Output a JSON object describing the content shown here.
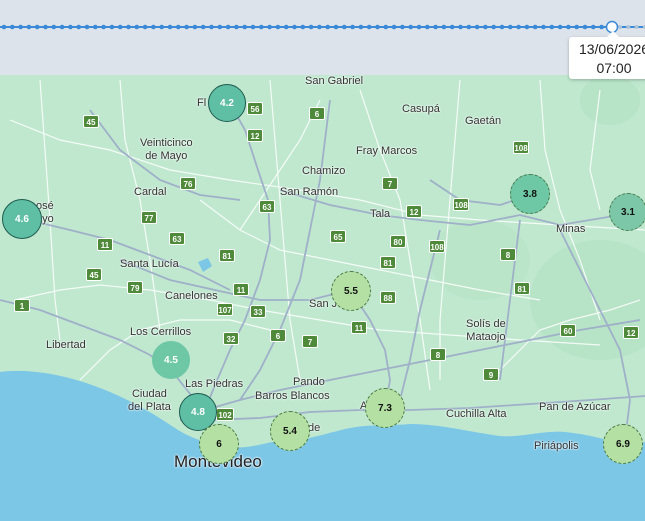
{
  "time_slider": {
    "date": "13/06/2026",
    "time": "07:00"
  },
  "places": [
    {
      "id": "san-gabriel",
      "name": "San Gabriel"
    },
    {
      "id": "casupa",
      "name": "Casupá"
    },
    {
      "id": "gaetan",
      "name": "Gaetán"
    },
    {
      "id": "veinticinco-de-mayo",
      "name": "Veinticinco\nde Mayo"
    },
    {
      "id": "chamizo",
      "name": "Chamizo"
    },
    {
      "id": "fray-marcos",
      "name": "Fray Marcos"
    },
    {
      "id": "cardal",
      "name": "Cardal"
    },
    {
      "id": "san-ramon",
      "name": "San Ramón"
    },
    {
      "id": "tala",
      "name": "Tala"
    },
    {
      "id": "minas",
      "name": "Minas"
    },
    {
      "id": "san-jose",
      "name": "osé\nayo"
    },
    {
      "id": "santa-lucia",
      "name": "Santa Lucía"
    },
    {
      "id": "canelones",
      "name": "Canelones"
    },
    {
      "id": "san-jacinto",
      "name": "San J"
    },
    {
      "id": "los-cerrillos",
      "name": "Los Cerrillos"
    },
    {
      "id": "libertad",
      "name": "Libertad"
    },
    {
      "id": "solis-de-mataojo",
      "name": "Solís de\nMataojo"
    },
    {
      "id": "las-piedras",
      "name": "Las Piedras"
    },
    {
      "id": "pando",
      "name": "Pando"
    },
    {
      "id": "ciudad-del-plata",
      "name": "Ciudad\ndel Plata"
    },
    {
      "id": "barros-blancos",
      "name": "Barros Blancos"
    },
    {
      "id": "cuchilla-alta",
      "name": "Cuchilla Alta"
    },
    {
      "id": "pan-de-azucar",
      "name": "Pan de Azúcar"
    },
    {
      "id": "piriapolis",
      "name": "Piriápolis"
    },
    {
      "id": "montevideo",
      "name": "Montevideo"
    },
    {
      "id": "florida",
      "name": "Fl"
    },
    {
      "id": "atlantida",
      "name": "A"
    },
    {
      "id": "de",
      "name": "de"
    }
  ],
  "route_shields": [
    "56",
    "6",
    "12",
    "45",
    "76",
    "7",
    "108",
    "63",
    "77",
    "12",
    "65",
    "108",
    "11",
    "81",
    "63",
    "80",
    "45",
    "81",
    "108",
    "8",
    "1",
    "79",
    "107",
    "11",
    "88",
    "33",
    "81",
    "32",
    "6",
    "7",
    "60",
    "11",
    "12",
    "8",
    "9",
    "102"
  ],
  "markers": [
    {
      "id": "florida",
      "value": "4.2"
    },
    {
      "id": "san-jose",
      "value": "4.6"
    },
    {
      "id": "solis-area",
      "value": "3.8"
    },
    {
      "id": "minas",
      "value": "3.1"
    },
    {
      "id": "san-jacinto",
      "value": "5.5"
    },
    {
      "id": "los-cerrillos",
      "value": "4.5"
    },
    {
      "id": "las-piedras",
      "value": "4.8"
    },
    {
      "id": "montevideo",
      "value": "6"
    },
    {
      "id": "barros-blancos",
      "value": "5.4"
    },
    {
      "id": "atlantida",
      "value": "7.3"
    },
    {
      "id": "piriapolis",
      "value": "6.9"
    }
  ],
  "colors": {
    "land": "#bfe8cf",
    "water": "#7cc6e6",
    "road": "#ffffff",
    "highway": "#9fb0c8",
    "shield": "#4f8a3a",
    "marker_dark": "#5fbfa4",
    "marker_light": "#b4e0a4",
    "timeline": "#3a8ad8"
  }
}
